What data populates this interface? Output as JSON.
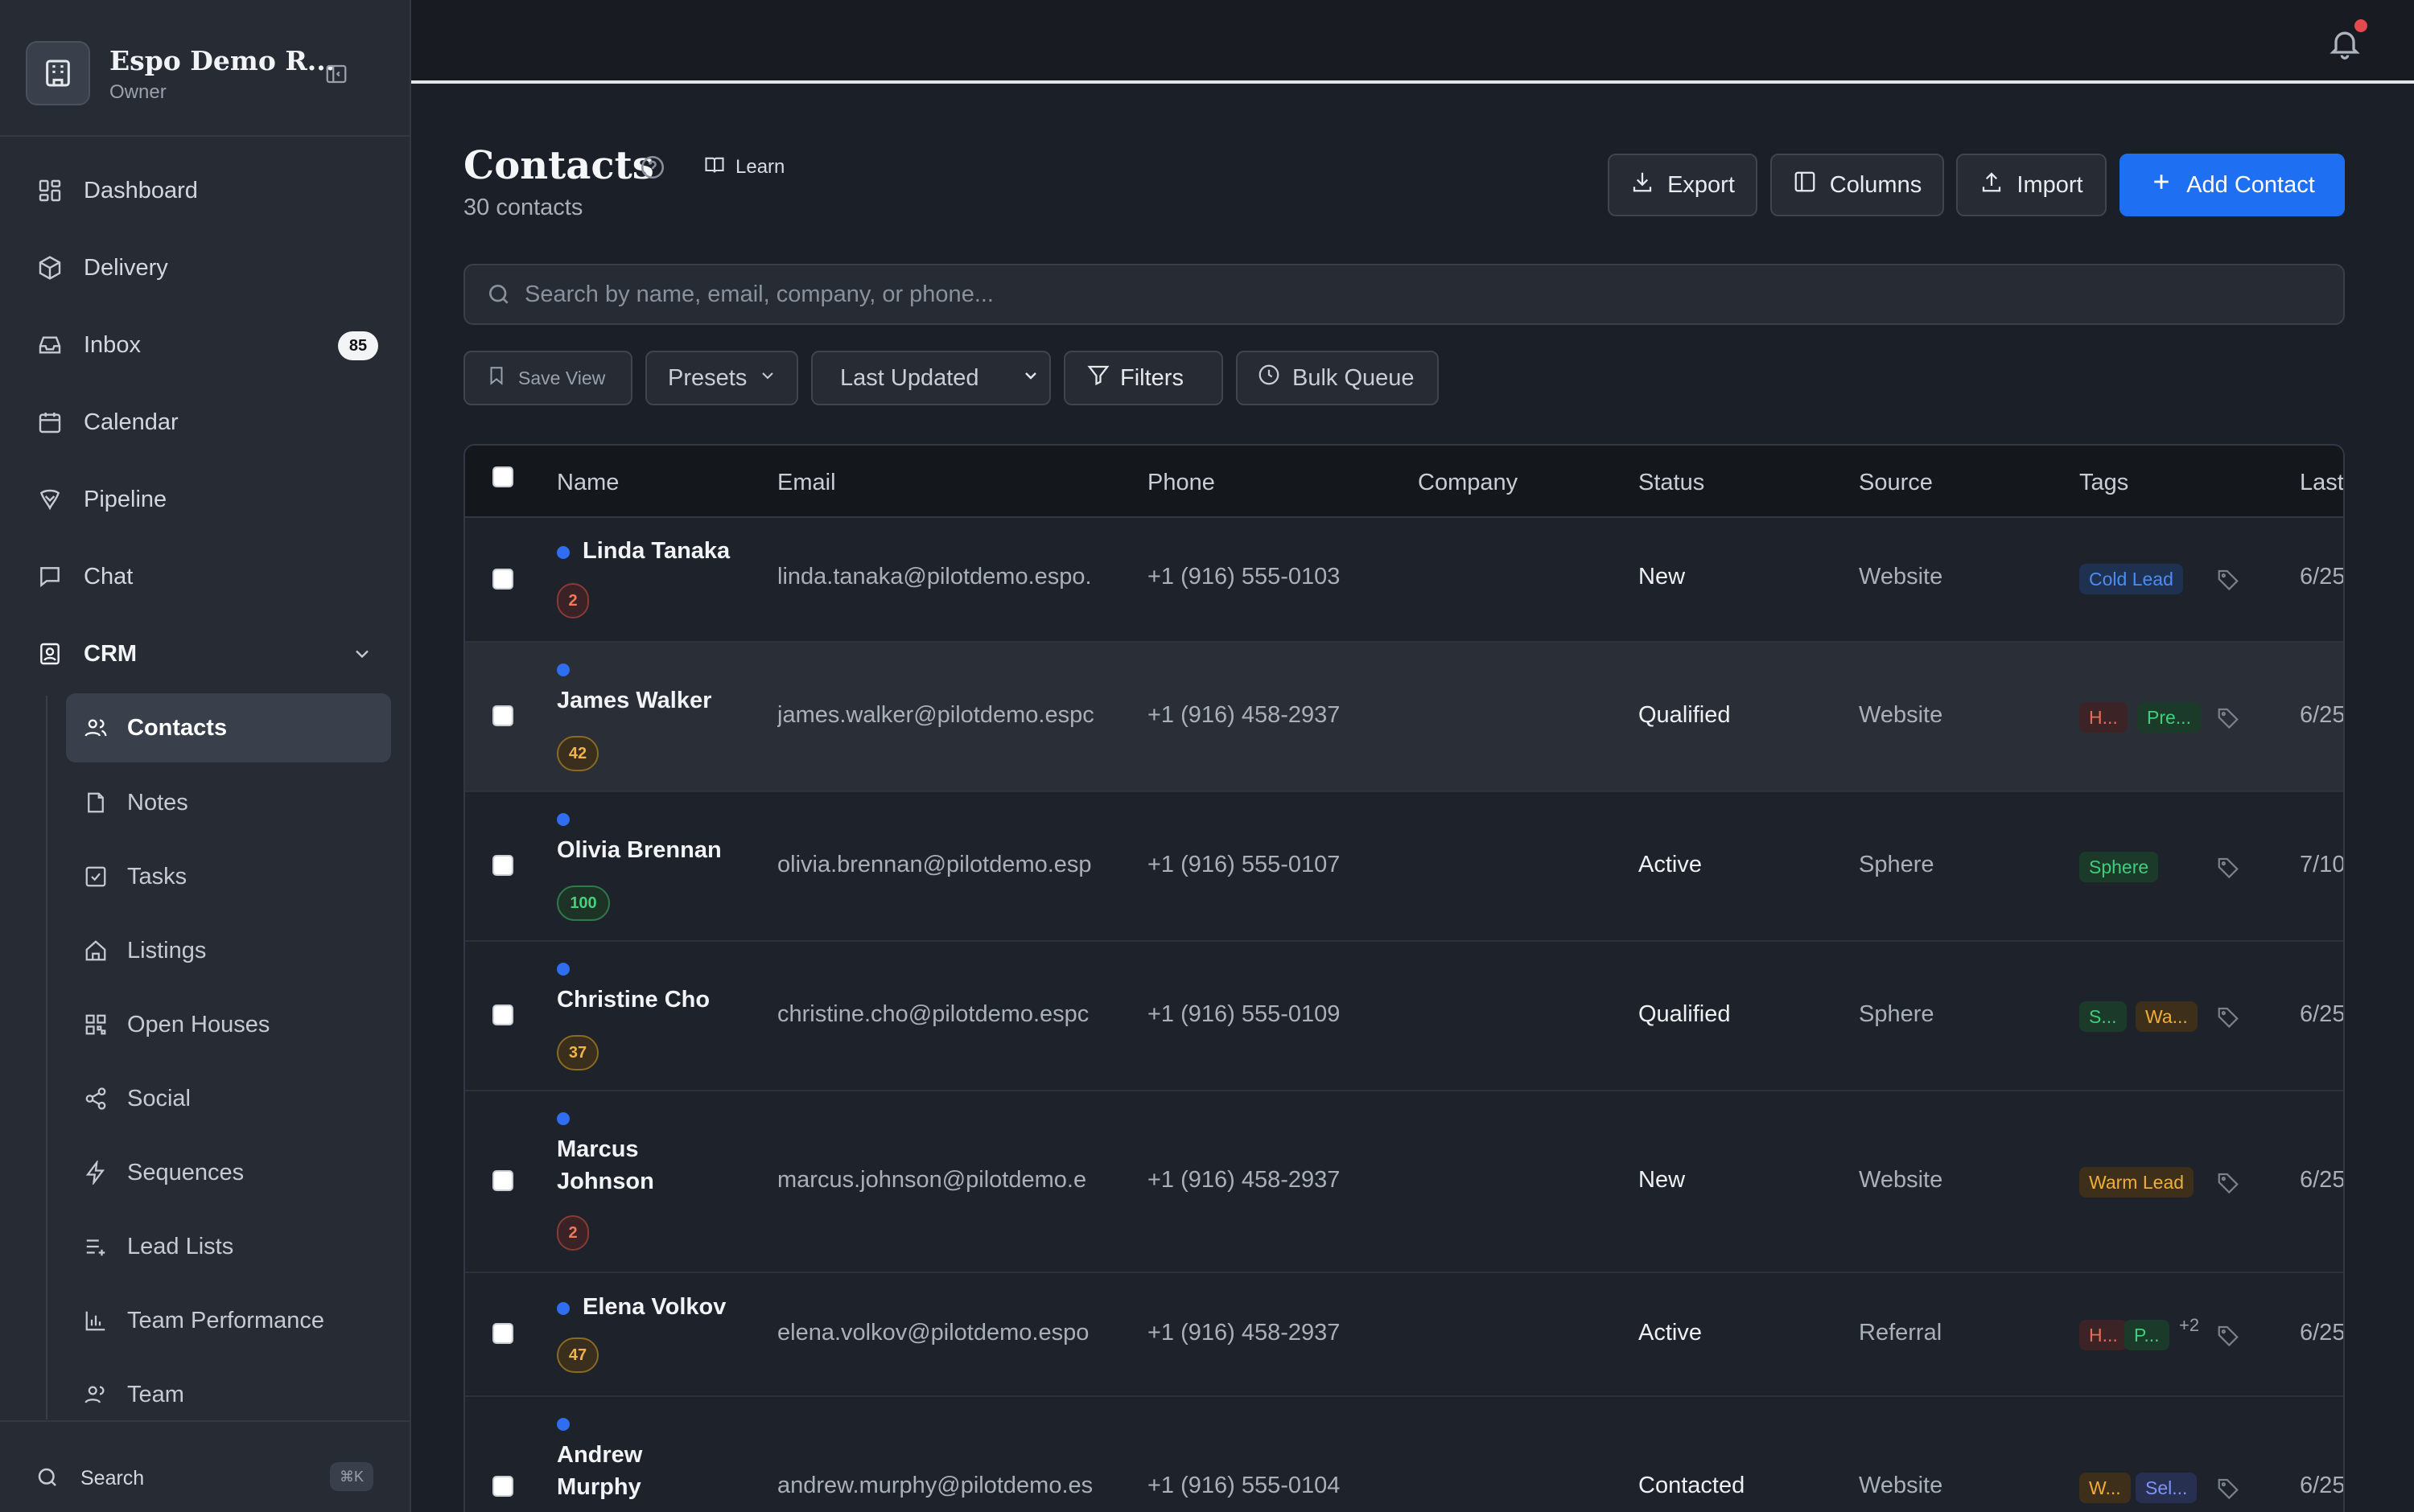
{
  "workspace": {
    "name": "Espo Demo R...",
    "role": "Owner"
  },
  "nav": [
    {
      "label": "Dashboard",
      "icon": "dashboard-icon"
    },
    {
      "label": "Delivery",
      "icon": "package-icon"
    },
    {
      "label": "Inbox",
      "icon": "inbox-icon",
      "badge": "85"
    },
    {
      "label": "Calendar",
      "icon": "calendar-icon"
    },
    {
      "label": "Pipeline",
      "icon": "pipeline-icon"
    },
    {
      "label": "Chat",
      "icon": "chat-icon"
    },
    {
      "label": "CRM",
      "icon": "contact-book-icon",
      "expanded": true
    }
  ],
  "crm_subnav": [
    {
      "label": "Contacts",
      "icon": "users-icon",
      "active": true
    },
    {
      "label": "Notes",
      "icon": "note-icon"
    },
    {
      "label": "Tasks",
      "icon": "task-icon"
    },
    {
      "label": "Listings",
      "icon": "home-icon"
    },
    {
      "label": "Open Houses",
      "icon": "qr-icon"
    },
    {
      "label": "Social",
      "icon": "share-icon"
    },
    {
      "label": "Sequences",
      "icon": "bolt-icon"
    },
    {
      "label": "Lead Lists",
      "icon": "list-plus-icon"
    },
    {
      "label": "Team Performance",
      "icon": "bar-chart-icon"
    },
    {
      "label": "Team",
      "icon": "team-icon"
    }
  ],
  "sidebar_search": {
    "label": "Search",
    "shortcut": "⌘K"
  },
  "header": {
    "title": "Contacts",
    "learn_label": "Learn",
    "subtitle": "30 contacts"
  },
  "actions": {
    "export": "Export",
    "columns": "Columns",
    "import": "Import",
    "add_contact": "Add Contact"
  },
  "search": {
    "placeholder": "Search by name, email, company, or phone..."
  },
  "filters": {
    "save_view": "Save View",
    "presets": "Presets",
    "sort_selected": "Last Updated",
    "filters": "Filters",
    "bulk_queue": "Bulk Queue"
  },
  "table": {
    "columns": [
      "Name",
      "Email",
      "Phone",
      "Company",
      "Status",
      "Source",
      "Tags",
      "Last"
    ],
    "rows": [
      {
        "name": "Linda Tanaka",
        "score": "2",
        "email": "linda.tanaka@pilotdemo.espo.",
        "phone": "+1 (916) 555-0103",
        "company": "",
        "status": "New",
        "source": "Website",
        "tags": [
          "Cold Lead"
        ],
        "more": "",
        "last": "6/25"
      },
      {
        "name": "James Walker",
        "score": "42",
        "email": "james.walker@pilotdemo.espc",
        "phone": "+1 (916) 458-2937",
        "company": "",
        "status": "Qualified",
        "source": "Website",
        "tags": [
          "H...",
          "Pre..."
        ],
        "more": "",
        "last": "6/25"
      },
      {
        "name": "Olivia Brennan",
        "score": "100",
        "email": "olivia.brennan@pilotdemo.esp",
        "phone": "+1 (916) 555-0107",
        "company": "",
        "status": "Active",
        "source": "Sphere",
        "tags": [
          "Sphere"
        ],
        "more": "",
        "last": "7/10"
      },
      {
        "name": "Christine Cho",
        "score": "37",
        "email": "christine.cho@pilotdemo.espc",
        "phone": "+1 (916) 555-0109",
        "company": "",
        "status": "Qualified",
        "source": "Sphere",
        "tags": [
          "S...",
          "Wa..."
        ],
        "more": "",
        "last": "6/25"
      },
      {
        "name": "Marcus Johnson",
        "name_line1": "Marcus",
        "name_line2": "Johnson",
        "score": "2",
        "email": "marcus.johnson@pilotdemo.e",
        "phone": "+1 (916) 458-2937",
        "company": "",
        "status": "New",
        "source": "Website",
        "tags": [
          "Warm Lead"
        ],
        "more": "",
        "last": "6/25"
      },
      {
        "name": "Elena Volkov",
        "score": "47",
        "email": "elena.volkov@pilotdemo.espo",
        "phone": "+1 (916) 458-2937",
        "company": "",
        "status": "Active",
        "source": "Referral",
        "tags": [
          "H...",
          "P..."
        ],
        "more": "+2",
        "last": "6/25"
      },
      {
        "name": "Andrew Murphy",
        "name_line1": "Andrew",
        "name_line2": "Murphy",
        "score": "",
        "email": "andrew.murphy@pilotdemo.es",
        "phone": "+1 (916) 555-0104",
        "company": "",
        "status": "Contacted",
        "source": "Website",
        "tags": [
          "W...",
          "Sel..."
        ],
        "more": "",
        "last": "6/25"
      }
    ]
  },
  "colors": {
    "accent": "#1f6ff2",
    "notification": "#e5484d",
    "background": "#1b1f27"
  }
}
